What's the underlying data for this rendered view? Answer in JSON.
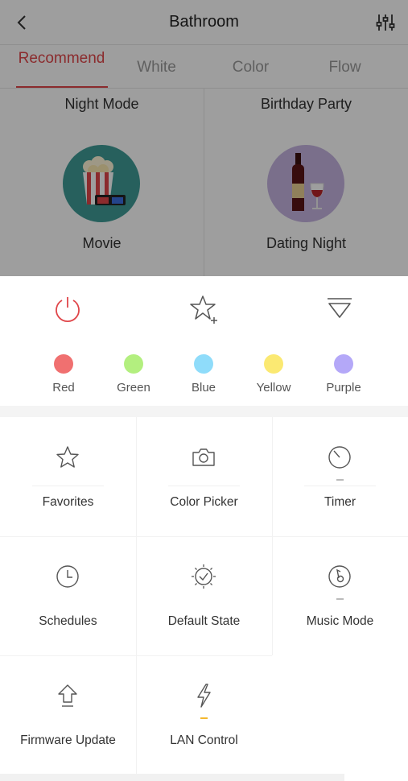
{
  "header": {
    "title": "Bathroom",
    "back_icon": "chevron-left-icon",
    "settings_icon": "sliders-icon"
  },
  "tabs": [
    {
      "label": "Recommend",
      "active": true
    },
    {
      "label": "White",
      "active": false
    },
    {
      "label": "Color",
      "active": false
    },
    {
      "label": "Flow",
      "active": false
    }
  ],
  "scenes": {
    "top_row": [
      "Night Mode",
      "Birthday Party"
    ],
    "cards": [
      {
        "label": "Movie",
        "icon": "popcorn-3d-glasses-icon",
        "bg_color": "#3f9c97"
      },
      {
        "label": "Dating Night",
        "icon": "wine-bottle-glass-icon",
        "bg_color": "#c5b3e0"
      }
    ]
  },
  "quick_actions": [
    {
      "name": "power",
      "icon": "power-icon",
      "color": "#e0464a"
    },
    {
      "name": "add-favorite",
      "icon": "star-plus-icon",
      "color": "#555555"
    },
    {
      "name": "collapse",
      "icon": "dropdown-triangle-icon",
      "color": "#555555"
    }
  ],
  "colors": [
    {
      "label": "Red",
      "hex": "#f07070"
    },
    {
      "label": "Green",
      "hex": "#b3ef7f"
    },
    {
      "label": "Blue",
      "hex": "#8fdcfa"
    },
    {
      "label": "Yellow",
      "hex": "#fbe972"
    },
    {
      "label": "Purple",
      "hex": "#b4a8f8"
    }
  ],
  "features": [
    {
      "label": "Favorites",
      "icon": "star-icon"
    },
    {
      "label": "Color Picker",
      "icon": "camera-icon"
    },
    {
      "label": "Timer",
      "icon": "timer-icon"
    },
    {
      "label": "Schedules",
      "icon": "clock-icon"
    },
    {
      "label": "Default State",
      "icon": "check-sun-icon"
    },
    {
      "label": "Music Mode",
      "icon": "music-note-icon"
    },
    {
      "label": "Firmware Update",
      "icon": "upload-arrow-icon"
    },
    {
      "label": "LAN Control",
      "icon": "lightning-icon"
    }
  ]
}
